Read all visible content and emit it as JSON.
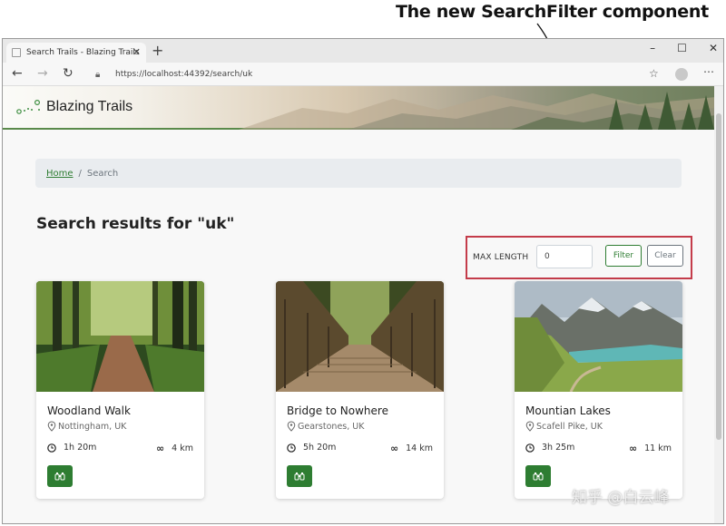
{
  "annotation": {
    "title": "The new SearchFilter component"
  },
  "browser": {
    "tab_title": "Search Trails - Blazing Trails",
    "tab_close": "✕",
    "new_tab": "+",
    "window_controls": {
      "minimize": "–",
      "maximize": "☐",
      "close": "✕"
    },
    "nav": {
      "back": "←",
      "forward": "→",
      "reload": "↻"
    },
    "url": "https://localhost:44392/search/uk",
    "more": "⋯"
  },
  "header": {
    "logo_text": "Blazing Trails"
  },
  "breadcrumb": {
    "home": "Home",
    "separator": "/",
    "current": "Search"
  },
  "page": {
    "title": "Search results for \"uk\""
  },
  "filter": {
    "label": "MAX LENGTH",
    "input_value": "0",
    "filter_button": "Filter",
    "clear_button": "Clear"
  },
  "cards": [
    {
      "title": "Woodland Walk",
      "location": "Nottingham, UK",
      "time": "1h 20m",
      "length": "4 km"
    },
    {
      "title": "Bridge to Nowhere",
      "location": "Gearstones, UK",
      "time": "5h 20m",
      "length": "14 km"
    },
    {
      "title": "Mountian Lakes",
      "location": "Scafell Pike, UK",
      "time": "3h 25m",
      "length": "11 km"
    }
  ],
  "icons": {
    "location": "map-pin-icon",
    "time": "clock-icon",
    "length": "infinity-icon",
    "view": "binoculars-icon"
  },
  "colors": {
    "accent": "#2e7d32",
    "highlight_border": "#c43c4a",
    "breadcrumb_bg": "#e9ecef"
  },
  "watermark": "知乎 @白云峰"
}
